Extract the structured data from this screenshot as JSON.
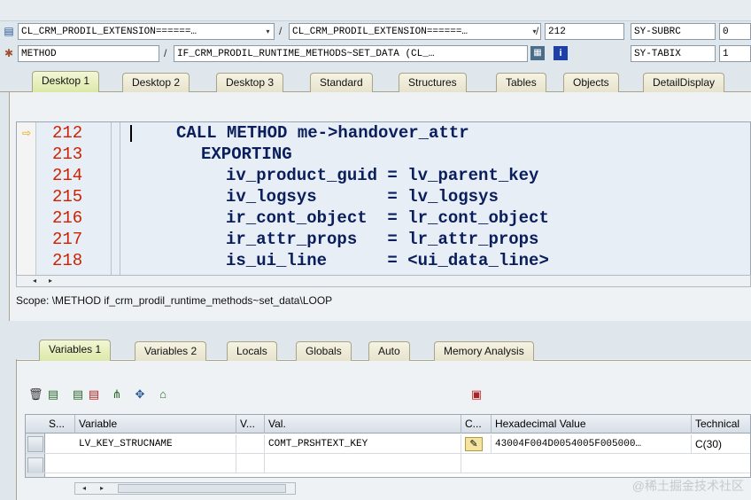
{
  "header": {
    "row1": {
      "program1": "CL_CRM_PRODIL_EXTENSION======…",
      "program2": "CL_CRM_PRODIL_EXTENSION======…",
      "line": "212",
      "sysvar": "SY-SUBRC",
      "sysval": "0"
    },
    "row2": {
      "event_type": "METHOD",
      "event": "IF_CRM_PRODIL_RUNTIME_METHODS~SET_DATA (CL_…",
      "sysvar": "SY-TABIX",
      "sysval": "1"
    },
    "separator": "/"
  },
  "desktop_tabs": [
    "Desktop 1",
    "Desktop 2",
    "Desktop 3",
    "Standard",
    "Structures",
    "Tables",
    "Objects",
    "DetailDisplay"
  ],
  "editor": {
    "lines": [
      {
        "num": "212",
        "text": "CALL METHOD me->handover_attr"
      },
      {
        "num": "213",
        "text": "EXPORTING"
      },
      {
        "num": "214",
        "text": "iv_product_guid = lv_parent_key"
      },
      {
        "num": "215",
        "text": "iv_logsys       = lv_logsys"
      },
      {
        "num": "216",
        "text": "ir_cont_object  = lr_cont_object"
      },
      {
        "num": "217",
        "text": "ir_attr_props   = lr_attr_props"
      },
      {
        "num": "218",
        "text": "is_ui_line      = <ui_data_line>"
      }
    ]
  },
  "scope": "Scope: \\METHOD if_crm_prodil_runtime_methods~set_data\\LOOP",
  "variable_tabs": [
    "Variables 1",
    "Variables 2",
    "Locals",
    "Globals",
    "Auto",
    "Memory Analysis"
  ],
  "table": {
    "headers": [
      "S...",
      "Variable",
      "V...",
      "Val.",
      "C...",
      "Hexadecimal Value",
      "Technical"
    ],
    "rows": [
      {
        "variable": "LV_KEY_STRUCNAME",
        "value": "COMT_PRSHTEXT_KEY",
        "hex": "43004F004D0054005F005000…",
        "technical": "C(30)"
      }
    ]
  },
  "watermark": "@稀土掘金技术社区",
  "colors": {
    "line_number": "#cc2200",
    "keyword": "#b1165a",
    "code": "#0a1e5c",
    "active_tab": "#dce8a8"
  }
}
